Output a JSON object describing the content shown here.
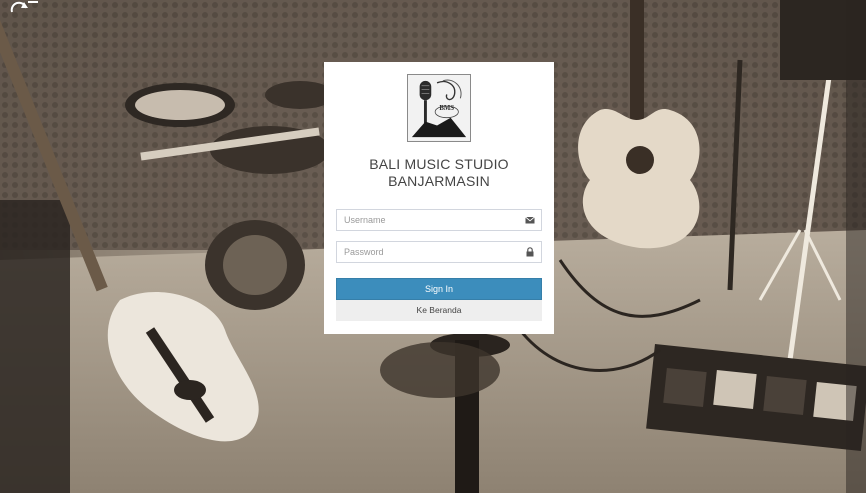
{
  "app": {
    "title_line1": "BALI MUSIC STUDIO",
    "title_line2": "BANJARMASIN",
    "logo_text": "BMS"
  },
  "form": {
    "username_placeholder": "Username",
    "username_value": "",
    "password_placeholder": "Password",
    "password_value": "",
    "signin_label": "Sign In",
    "home_label": "Ke Beranda"
  },
  "icons": {
    "username": "envelope-icon",
    "password": "lock-icon",
    "corner": "refresh-icon"
  },
  "colors": {
    "primary": "#3c8dbc",
    "secondary_button": "#eeeeee",
    "panel": "#ffffff",
    "text": "#444444"
  }
}
